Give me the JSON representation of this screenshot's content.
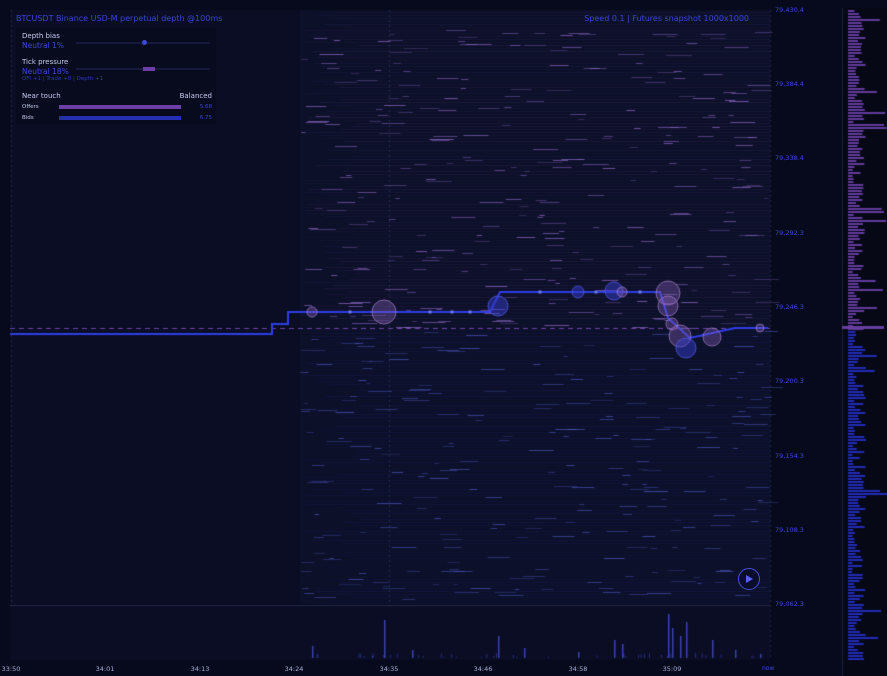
{
  "header": {
    "title": "BTCUSDT Binance USD-M perpetual depth @100ms",
    "status": "Speed 0.1 | Futures snapshot 1000x1000"
  },
  "depth_bias": {
    "title": "Depth bias",
    "value": "Neutral 1%",
    "level": 0.51
  },
  "tick_pressure": {
    "title": "Tick pressure",
    "value": "Neutral 18%",
    "level": 0.59
  },
  "tick_note": "OFI +1 | Trade +0 | Depth +1",
  "near_touch": {
    "label": "Near touch",
    "status": "Balanced",
    "offers": {
      "label": "Offers",
      "value": "5.68",
      "fraction": 1.0
    },
    "bids": {
      "label": "Bids",
      "value": "6.75",
      "fraction": 1.0
    }
  },
  "price_axis": [
    "79,430.4",
    "79,384.4",
    "79,338.4",
    "79,292.3",
    "79,246.3",
    "79,200.3",
    "79,154.3",
    "79,108.3",
    "79,062.3"
  ],
  "time_axis": [
    "33:50",
    "34:01",
    "34:13",
    "34:24",
    "34:35",
    "34:46",
    "34:58",
    "35:09"
  ],
  "live_tag": "now",
  "colors": {
    "background": "#070a1c",
    "ask": "#6c40a8",
    "bid": "#2530b0",
    "price_line": "#2f3de6",
    "trade_bubble": "#9a6fc8",
    "accent_text": "#3a46d8"
  },
  "play_button": {
    "icon": "play-icon"
  }
}
